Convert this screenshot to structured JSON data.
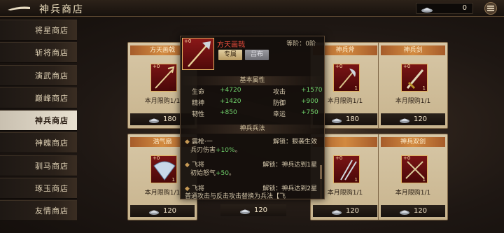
{
  "header": {
    "title": "神兵商店",
    "currency_value": "0"
  },
  "sidebar": {
    "items": [
      {
        "label": "将星商店",
        "active": false
      },
      {
        "label": "斩将商店",
        "active": false
      },
      {
        "label": "演武商店",
        "active": false
      },
      {
        "label": "巅峰商店",
        "active": false
      },
      {
        "label": "神兵商店",
        "active": true
      },
      {
        "label": "神魄商店",
        "active": false
      },
      {
        "label": "驯马商店",
        "active": false
      },
      {
        "label": "琢玉商店",
        "active": false
      },
      {
        "label": "友情商店",
        "active": false
      }
    ]
  },
  "cards": [
    {
      "name": "方天画戟",
      "level": "+0",
      "count": "",
      "limit": "本月限购1/1",
      "price": "180"
    },
    {
      "name": "",
      "level": "",
      "count": "",
      "limit": "",
      "price": ""
    },
    {
      "name": "神兵斧",
      "level": "+0",
      "count": "1",
      "limit": "本月限购1/1",
      "price": "180"
    },
    {
      "name": "神兵剑",
      "level": "+0",
      "count": "1",
      "limit": "本月限购1/1",
      "price": "120"
    },
    {
      "name": "浩气扇",
      "level": "+0",
      "count": "1",
      "limit": "本月限购1/1",
      "price": "120"
    },
    {
      "name": "",
      "level": "",
      "count": "",
      "limit": "",
      "price": "120"
    },
    {
      "name": "",
      "level": "+0",
      "count": "1",
      "limit": "本月限购1/1",
      "price": "120"
    },
    {
      "name": "神兵双剑",
      "level": "+0",
      "count": "1",
      "limit": "本月限购1/1",
      "price": "120"
    }
  ],
  "detail": {
    "level": "+0",
    "name": "方天画戟",
    "grade": "等阶：0阶",
    "tab_exclusive": "专属",
    "tab_other": "吕布",
    "basic_title": "基本属性",
    "stats": [
      {
        "k": "生命",
        "v": "+4720"
      },
      {
        "k": "攻击",
        "v": "+1570"
      },
      {
        "k": "精神",
        "v": "+1420"
      },
      {
        "k": "防御",
        "v": "+900"
      },
      {
        "k": "韧性",
        "v": "+850"
      },
      {
        "k": "幸运",
        "v": "+750"
      }
    ],
    "skill_title": "神兵兵法",
    "skills": [
      {
        "name": "震枪·一",
        "unlock": "解锁：狠袭生效",
        "desc_a": "兵刃伤害",
        "desc_b": "+10%",
        "desc_c": "。"
      },
      {
        "name": "飞将",
        "unlock": "解锁：神兵达到1星",
        "desc_a": "初始怒气",
        "desc_b": "+50",
        "desc_c": "。"
      },
      {
        "name": "飞将",
        "unlock": "解锁：神兵达到2星",
        "desc_a": "普通攻击与反击攻击替换为兵法【飞",
        "desc_b": "",
        "desc_c": ""
      }
    ]
  }
}
